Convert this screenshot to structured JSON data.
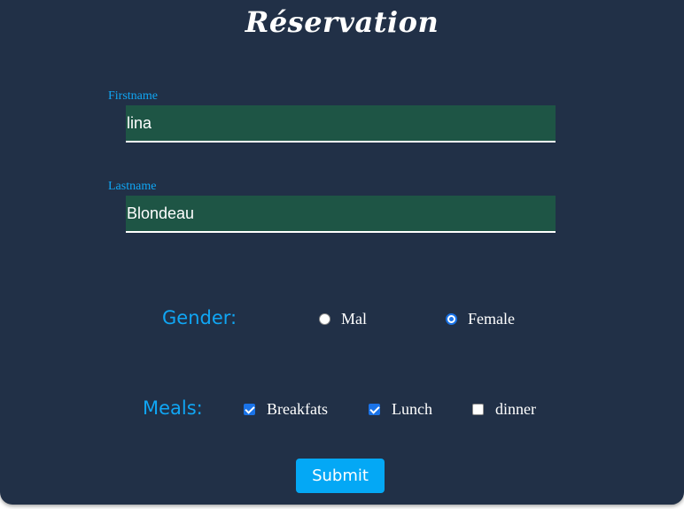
{
  "form": {
    "title": "Réservation",
    "firstname": {
      "label": "Firstname",
      "value": "lina"
    },
    "lastname": {
      "label": "Lastname",
      "value": "Blondeau"
    },
    "gender": {
      "label": "Gender:",
      "options": [
        {
          "label": "Mal",
          "checked": false
        },
        {
          "label": "Female",
          "checked": true
        }
      ]
    },
    "meals": {
      "label": "Meals:",
      "options": [
        {
          "label": "Breakfats",
          "checked": true
        },
        {
          "label": "Lunch",
          "checked": true
        },
        {
          "label": "dinner",
          "checked": false
        }
      ]
    },
    "submit_label": "Submit"
  },
  "colors": {
    "card_background": "#213047",
    "accent": "#10a6f4",
    "input_background": "#1e5545",
    "button": "#04a8f5"
  }
}
